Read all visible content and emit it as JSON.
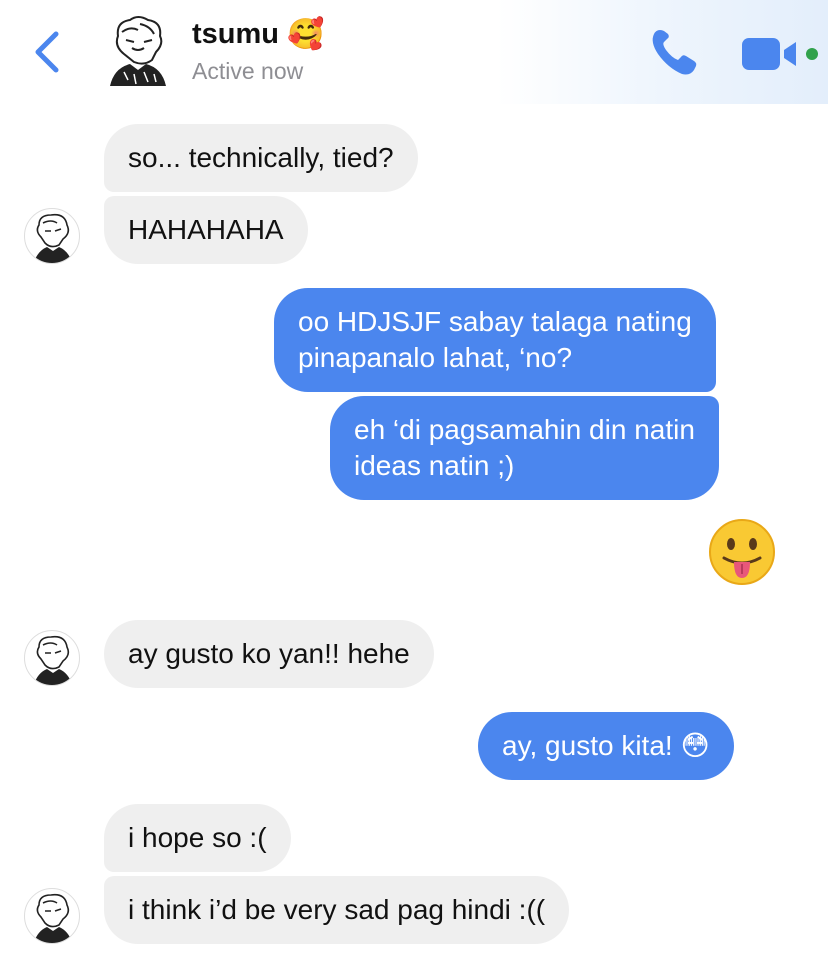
{
  "header": {
    "contact_name": "tsumu",
    "contact_emoji": "🥰",
    "status": "Active now",
    "back_icon": "chevron-left-icon",
    "call_icon": "phone-icon",
    "video_icon": "video-camera-icon",
    "accent_color": "#4b86ee",
    "online_color": "#31a24c"
  },
  "messages": [
    {
      "sender": "contact",
      "text": "so... technically, tied?"
    },
    {
      "sender": "contact",
      "text": "HAHAHAHA"
    },
    {
      "sender": "me",
      "line1": "oo HDJSJF sabay talaga nating",
      "line2": "pinapanalo lahat, ‘no?"
    },
    {
      "sender": "me",
      "line1": "eh ‘di pagsamahin din natin",
      "line2": "ideas natin ;)"
    },
    {
      "sender": "me",
      "emoji": "😛"
    },
    {
      "sender": "contact",
      "text": "ay gusto ko yan!! hehe"
    },
    {
      "sender": "me",
      "text": "ay, gusto kita!",
      "emoji": "😳"
    },
    {
      "sender": "contact",
      "text": "i hope so :("
    },
    {
      "sender": "contact",
      "text": "i think i’d be very sad pag hindi :(("
    }
  ],
  "colors": {
    "incoming_bubble": "#efefef",
    "outgoing_bubble": "#4b86ee"
  }
}
